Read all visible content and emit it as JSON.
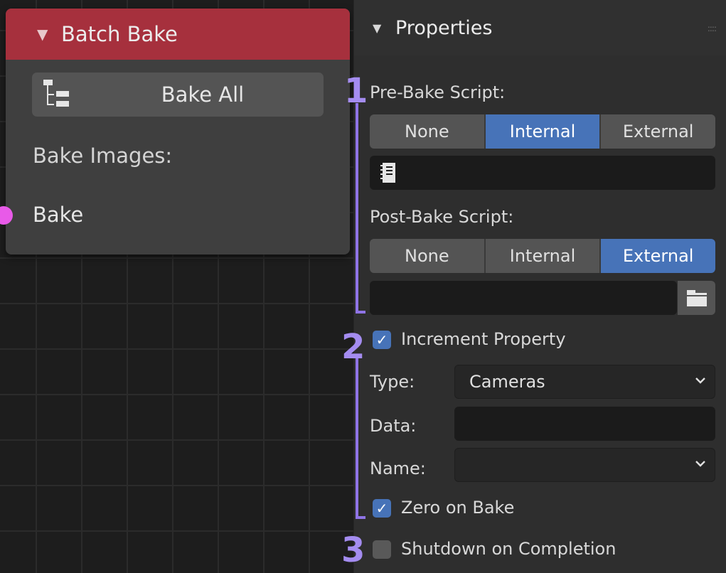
{
  "node": {
    "title": "Batch Bake",
    "bake_all_label": "Bake All",
    "bake_images_label": "Bake Images:",
    "socket_label": "Bake",
    "header_color": "#a6303d",
    "socket_color": "#e85ae8"
  },
  "panel": {
    "title": "Properties",
    "pre_bake": {
      "label": "Pre-Bake Script:",
      "options": [
        "None",
        "Internal",
        "External"
      ],
      "selected": "Internal"
    },
    "post_bake": {
      "label": "Post-Bake Script:",
      "options": [
        "None",
        "Internal",
        "External"
      ],
      "selected": "External"
    },
    "increment": {
      "label": "Increment Property",
      "checked": true,
      "type_label": "Type:",
      "type_value": "Cameras",
      "data_label": "Data:",
      "data_value": "",
      "name_label": "Name:",
      "name_value": ""
    },
    "zero_on_bake": {
      "label": "Zero on Bake",
      "checked": true
    },
    "shutdown": {
      "label": "Shutdown on Completion",
      "checked": false
    }
  },
  "annotations": [
    "1",
    "2",
    "3"
  ],
  "colors": {
    "accent": "#4773b8",
    "annotation": "#a48cf0"
  },
  "icons": [
    "collapse-triangle-icon",
    "tree-hierarchy-icon",
    "text-document-icon",
    "folder-icon",
    "chevron-down-icon",
    "checkmark-icon"
  ]
}
